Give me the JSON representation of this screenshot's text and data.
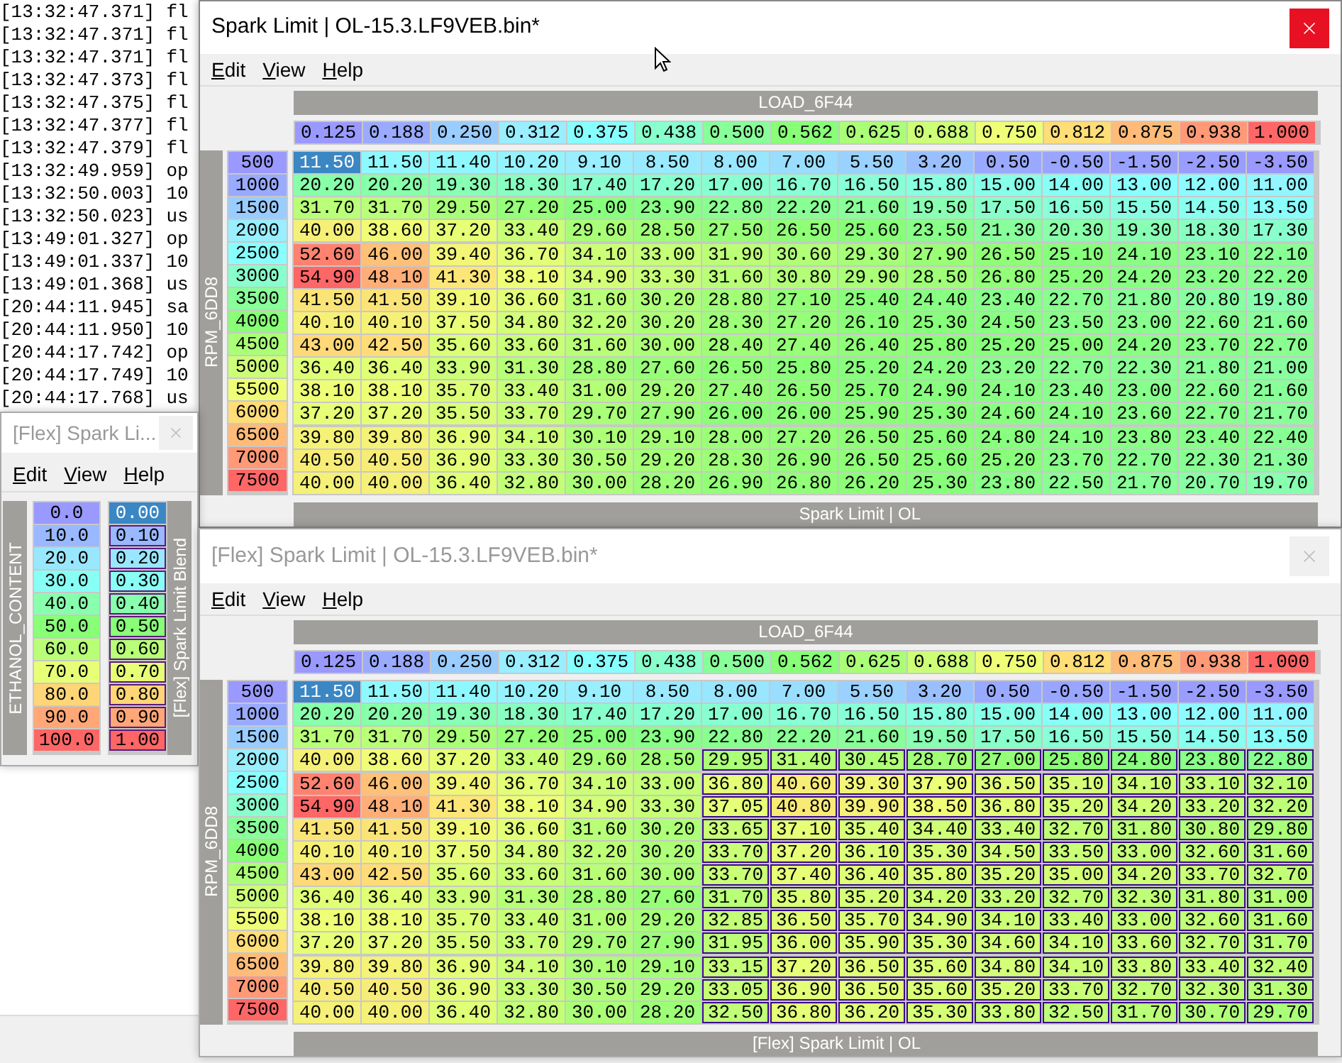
{
  "log": [
    {
      "time": "[13:32:47.371]",
      "text": "fl"
    },
    {
      "time": "[13:32:47.371]",
      "text": "fl"
    },
    {
      "time": "[13:32:47.371]",
      "text": "fl"
    },
    {
      "time": "[13:32:47.373]",
      "text": "fl"
    },
    {
      "time": "[13:32:47.375]",
      "text": "fl"
    },
    {
      "time": "[13:32:47.377]",
      "text": "fl"
    },
    {
      "time": "[13:32:47.379]",
      "text": "fl"
    },
    {
      "time": "[13:32:49.959]",
      "text": "op"
    },
    {
      "time": "[13:32:50.003]",
      "text": "10"
    },
    {
      "time": "[13:32:50.023]",
      "text": "us"
    },
    {
      "time": "[13:49:01.327]",
      "text": "op"
    },
    {
      "time": "[13:49:01.337]",
      "text": "10"
    },
    {
      "time": "[13:49:01.368]",
      "text": "us"
    },
    {
      "time": "[20:44:11.945]",
      "text": "sa"
    },
    {
      "time": "[20:44:11.950]",
      "text": "10"
    },
    {
      "time": "[20:44:17.742]",
      "text": "op"
    },
    {
      "time": "[20:44:17.749]",
      "text": "10"
    },
    {
      "time": "[20:44:17.768]",
      "text": "us"
    }
  ],
  "windows": [
    {
      "kind": "map",
      "title": "Spark Limit | OL-15.3.LF9VEB.bin*",
      "active": true,
      "menu": [
        "Edit",
        "View",
        "Help"
      ],
      "x_label": "LOAD_6F44",
      "x_axis": [
        "0.125",
        "0.188",
        "0.250",
        "0.312",
        "0.375",
        "0.438",
        "0.500",
        "0.562",
        "0.625",
        "0.688",
        "0.750",
        "0.812",
        "0.875",
        "0.938",
        "1.000"
      ],
      "y_label": "RPM_6DD8",
      "footer": "Spark Limit | OL",
      "rows": [
        {
          "rpm": "500",
          "cells": [
            "11.50",
            "11.50",
            "11.40",
            "10.20",
            "9.10",
            "8.50",
            "8.00",
            "7.00",
            "5.50",
            "3.20",
            "0.50",
            "-0.50",
            "-1.50",
            "-2.50",
            "-3.50"
          ],
          "selected": [
            true,
            false,
            false,
            false,
            false,
            false,
            false,
            false,
            false,
            false,
            false,
            false,
            false,
            false,
            false
          ]
        },
        {
          "rpm": "1000",
          "cells": [
            "20.20",
            "20.20",
            "19.30",
            "18.30",
            "17.40",
            "17.20",
            "17.00",
            "16.70",
            "16.50",
            "15.80",
            "15.00",
            "14.00",
            "13.00",
            "12.00",
            "11.00"
          ],
          "selected": [
            false,
            false,
            false,
            false,
            false,
            false,
            false,
            false,
            false,
            false,
            false,
            false,
            false,
            false,
            false
          ]
        },
        {
          "rpm": "1500",
          "cells": [
            "31.70",
            "31.70",
            "29.50",
            "27.20",
            "25.00",
            "23.90",
            "22.80",
            "22.20",
            "21.60",
            "19.50",
            "17.50",
            "16.50",
            "15.50",
            "14.50",
            "13.50"
          ],
          "selected": [
            false,
            false,
            false,
            false,
            false,
            false,
            false,
            false,
            false,
            false,
            false,
            false,
            false,
            false,
            false
          ]
        },
        {
          "rpm": "2000",
          "cells": [
            "40.00",
            "38.60",
            "37.20",
            "33.40",
            "29.60",
            "28.50",
            "27.50",
            "26.50",
            "25.60",
            "23.50",
            "21.30",
            "20.30",
            "19.30",
            "18.30",
            "17.30"
          ],
          "selected": [
            false,
            false,
            false,
            false,
            false,
            false,
            false,
            false,
            false,
            false,
            false,
            false,
            false,
            false,
            false
          ]
        },
        {
          "rpm": "2500",
          "cells": [
            "52.60",
            "46.00",
            "39.40",
            "36.70",
            "34.10",
            "33.00",
            "31.90",
            "30.60",
            "29.30",
            "27.90",
            "26.50",
            "25.10",
            "24.10",
            "23.10",
            "22.10"
          ],
          "selected": [
            false,
            false,
            false,
            false,
            false,
            false,
            false,
            false,
            false,
            false,
            false,
            false,
            false,
            false,
            false
          ]
        },
        {
          "rpm": "3000",
          "cells": [
            "54.90",
            "48.10",
            "41.30",
            "38.10",
            "34.90",
            "33.30",
            "31.60",
            "30.80",
            "29.90",
            "28.50",
            "26.80",
            "25.20",
            "24.20",
            "23.20",
            "22.20"
          ],
          "selected": [
            false,
            false,
            false,
            false,
            false,
            false,
            false,
            false,
            false,
            false,
            false,
            false,
            false,
            false,
            false
          ]
        },
        {
          "rpm": "3500",
          "cells": [
            "41.50",
            "41.50",
            "39.10",
            "36.60",
            "31.60",
            "30.20",
            "28.80",
            "27.10",
            "25.40",
            "24.40",
            "23.40",
            "22.70",
            "21.80",
            "20.80",
            "19.80"
          ],
          "selected": [
            false,
            false,
            false,
            false,
            false,
            false,
            false,
            false,
            false,
            false,
            false,
            false,
            false,
            false,
            false
          ]
        },
        {
          "rpm": "4000",
          "cells": [
            "40.10",
            "40.10",
            "37.50",
            "34.80",
            "32.20",
            "30.20",
            "28.30",
            "27.20",
            "26.10",
            "25.30",
            "24.50",
            "23.50",
            "23.00",
            "22.60",
            "21.60"
          ],
          "selected": [
            false,
            false,
            false,
            false,
            false,
            false,
            false,
            false,
            false,
            false,
            false,
            false,
            false,
            false,
            false
          ]
        },
        {
          "rpm": "4500",
          "cells": [
            "43.00",
            "42.50",
            "35.60",
            "33.60",
            "31.60",
            "30.00",
            "28.40",
            "27.40",
            "26.40",
            "25.80",
            "25.20",
            "25.00",
            "24.20",
            "23.70",
            "22.70"
          ],
          "selected": [
            false,
            false,
            false,
            false,
            false,
            false,
            false,
            false,
            false,
            false,
            false,
            false,
            false,
            false,
            false
          ]
        },
        {
          "rpm": "5000",
          "cells": [
            "36.40",
            "36.40",
            "33.90",
            "31.30",
            "28.80",
            "27.60",
            "26.50",
            "25.80",
            "25.20",
            "24.20",
            "23.20",
            "22.70",
            "22.30",
            "21.80",
            "21.00"
          ],
          "selected": [
            false,
            false,
            false,
            false,
            false,
            false,
            false,
            false,
            false,
            false,
            false,
            false,
            false,
            false,
            false
          ]
        },
        {
          "rpm": "5500",
          "cells": [
            "38.10",
            "38.10",
            "35.70",
            "33.40",
            "31.00",
            "29.20",
            "27.40",
            "26.50",
            "25.70",
            "24.90",
            "24.10",
            "23.40",
            "23.00",
            "22.60",
            "21.60"
          ],
          "selected": [
            false,
            false,
            false,
            false,
            false,
            false,
            false,
            false,
            false,
            false,
            false,
            false,
            false,
            false,
            false
          ]
        },
        {
          "rpm": "6000",
          "cells": [
            "37.20",
            "37.20",
            "35.50",
            "33.70",
            "29.70",
            "27.90",
            "26.00",
            "26.00",
            "25.90",
            "25.30",
            "24.60",
            "24.10",
            "23.60",
            "22.70",
            "21.70"
          ],
          "selected": [
            false,
            false,
            false,
            false,
            false,
            false,
            false,
            false,
            false,
            false,
            false,
            false,
            false,
            false,
            false
          ]
        },
        {
          "rpm": "6500",
          "cells": [
            "39.80",
            "39.80",
            "36.90",
            "34.10",
            "30.10",
            "29.10",
            "28.00",
            "27.20",
            "26.50",
            "25.60",
            "24.80",
            "24.10",
            "23.80",
            "23.40",
            "22.40"
          ],
          "selected": [
            false,
            false,
            false,
            false,
            false,
            false,
            false,
            false,
            false,
            false,
            false,
            false,
            false,
            false,
            false
          ]
        },
        {
          "rpm": "7000",
          "cells": [
            "40.50",
            "40.50",
            "36.90",
            "33.30",
            "30.50",
            "29.20",
            "28.30",
            "26.90",
            "26.50",
            "25.60",
            "25.20",
            "23.70",
            "22.70",
            "22.30",
            "21.30"
          ],
          "selected": [
            false,
            false,
            false,
            false,
            false,
            false,
            false,
            false,
            false,
            false,
            false,
            false,
            false,
            false,
            false
          ]
        },
        {
          "rpm": "7500",
          "cells": [
            "40.00",
            "40.00",
            "36.40",
            "32.80",
            "30.00",
            "28.20",
            "26.90",
            "26.80",
            "26.20",
            "25.30",
            "23.80",
            "22.50",
            "21.70",
            "20.70",
            "19.70"
          ],
          "selected": [
            false,
            false,
            false,
            false,
            false,
            false,
            false,
            false,
            false,
            false,
            false,
            false,
            false,
            false,
            false
          ]
        }
      ]
    },
    {
      "kind": "blend",
      "title": "[Flex] Spark Li...",
      "active": false,
      "menu": [
        "Edit",
        "View",
        "Help"
      ],
      "y_label": "ETHANOL_CONTENT",
      "side_label": "[Flex] Spark Limit Blend",
      "rows": [
        {
          "axis": "0.0",
          "value": "0.00",
          "selected": true,
          "changed": false
        },
        {
          "axis": "10.0",
          "value": "0.10",
          "selected": false,
          "changed": true
        },
        {
          "axis": "20.0",
          "value": "0.20",
          "selected": false,
          "changed": true
        },
        {
          "axis": "30.0",
          "value": "0.30",
          "selected": false,
          "changed": true
        },
        {
          "axis": "40.0",
          "value": "0.40",
          "selected": false,
          "changed": true
        },
        {
          "axis": "50.0",
          "value": "0.50",
          "selected": false,
          "changed": true
        },
        {
          "axis": "60.0",
          "value": "0.60",
          "selected": false,
          "changed": true
        },
        {
          "axis": "70.0",
          "value": "0.70",
          "selected": false,
          "changed": true
        },
        {
          "axis": "80.0",
          "value": "0.80",
          "selected": false,
          "changed": true
        },
        {
          "axis": "90.0",
          "value": "0.90",
          "selected": false,
          "changed": true
        },
        {
          "axis": "100.0",
          "value": "1.00",
          "selected": false,
          "changed": true
        }
      ]
    },
    {
      "kind": "map",
      "title": "[Flex] Spark Limit | OL-15.3.LF9VEB.bin*",
      "active": false,
      "menu": [
        "Edit",
        "View",
        "Help"
      ],
      "x_label": "LOAD_6F44",
      "x_axis": [
        "0.125",
        "0.188",
        "0.250",
        "0.312",
        "0.375",
        "0.438",
        "0.500",
        "0.562",
        "0.625",
        "0.688",
        "0.750",
        "0.812",
        "0.875",
        "0.938",
        "1.000"
      ],
      "y_label": "RPM_6DD8",
      "footer": "[Flex] Spark Limit | OL",
      "rows": [
        {
          "rpm": "500",
          "cells": [
            "11.50",
            "11.50",
            "11.40",
            "10.20",
            "9.10",
            "8.50",
            "8.00",
            "7.00",
            "5.50",
            "3.20",
            "0.50",
            "-0.50",
            "-1.50",
            "-2.50",
            "-3.50"
          ],
          "selected": [
            true,
            false,
            false,
            false,
            false,
            false,
            false,
            false,
            false,
            false,
            false,
            false,
            false,
            false,
            false
          ],
          "changed": [
            false,
            false,
            false,
            false,
            false,
            false,
            false,
            false,
            false,
            false,
            false,
            false,
            false,
            false,
            false
          ]
        },
        {
          "rpm": "1000",
          "cells": [
            "20.20",
            "20.20",
            "19.30",
            "18.30",
            "17.40",
            "17.20",
            "17.00",
            "16.70",
            "16.50",
            "15.80",
            "15.00",
            "14.00",
            "13.00",
            "12.00",
            "11.00"
          ],
          "selected": [
            false,
            false,
            false,
            false,
            false,
            false,
            false,
            false,
            false,
            false,
            false,
            false,
            false,
            false,
            false
          ],
          "changed": [
            false,
            false,
            false,
            false,
            false,
            false,
            false,
            false,
            false,
            false,
            false,
            false,
            false,
            false,
            false
          ]
        },
        {
          "rpm": "1500",
          "cells": [
            "31.70",
            "31.70",
            "29.50",
            "27.20",
            "25.00",
            "23.90",
            "22.80",
            "22.20",
            "21.60",
            "19.50",
            "17.50",
            "16.50",
            "15.50",
            "14.50",
            "13.50"
          ],
          "selected": [
            false,
            false,
            false,
            false,
            false,
            false,
            false,
            false,
            false,
            false,
            false,
            false,
            false,
            false,
            false
          ],
          "changed": [
            false,
            false,
            false,
            false,
            false,
            false,
            false,
            false,
            false,
            false,
            false,
            false,
            false,
            false,
            false
          ]
        },
        {
          "rpm": "2000",
          "cells": [
            "40.00",
            "38.60",
            "37.20",
            "33.40",
            "29.60",
            "28.50",
            "29.95",
            "31.40",
            "30.45",
            "28.70",
            "27.00",
            "25.80",
            "24.80",
            "23.80",
            "22.80"
          ],
          "selected": [
            false,
            false,
            false,
            false,
            false,
            false,
            false,
            false,
            false,
            false,
            false,
            false,
            false,
            false,
            false
          ],
          "changed": [
            false,
            false,
            false,
            false,
            false,
            false,
            true,
            true,
            true,
            true,
            true,
            true,
            true,
            true,
            true
          ]
        },
        {
          "rpm": "2500",
          "cells": [
            "52.60",
            "46.00",
            "39.40",
            "36.70",
            "34.10",
            "33.00",
            "36.80",
            "40.60",
            "39.30",
            "37.90",
            "36.50",
            "35.10",
            "34.10",
            "33.10",
            "32.10"
          ],
          "selected": [
            false,
            false,
            false,
            false,
            false,
            false,
            false,
            false,
            false,
            false,
            false,
            false,
            false,
            false,
            false
          ],
          "changed": [
            false,
            false,
            false,
            false,
            false,
            false,
            true,
            true,
            true,
            true,
            true,
            true,
            true,
            true,
            true
          ]
        },
        {
          "rpm": "3000",
          "cells": [
            "54.90",
            "48.10",
            "41.30",
            "38.10",
            "34.90",
            "33.30",
            "37.05",
            "40.80",
            "39.90",
            "38.50",
            "36.80",
            "35.20",
            "34.20",
            "33.20",
            "32.20"
          ],
          "selected": [
            false,
            false,
            false,
            false,
            false,
            false,
            false,
            false,
            false,
            false,
            false,
            false,
            false,
            false,
            false
          ],
          "changed": [
            false,
            false,
            false,
            false,
            false,
            false,
            true,
            true,
            true,
            true,
            true,
            true,
            true,
            true,
            true
          ]
        },
        {
          "rpm": "3500",
          "cells": [
            "41.50",
            "41.50",
            "39.10",
            "36.60",
            "31.60",
            "30.20",
            "33.65",
            "37.10",
            "35.40",
            "34.40",
            "33.40",
            "32.70",
            "31.80",
            "30.80",
            "29.80"
          ],
          "selected": [
            false,
            false,
            false,
            false,
            false,
            false,
            false,
            false,
            false,
            false,
            false,
            false,
            false,
            false,
            false
          ],
          "changed": [
            false,
            false,
            false,
            false,
            false,
            false,
            true,
            true,
            true,
            true,
            true,
            true,
            true,
            true,
            true
          ]
        },
        {
          "rpm": "4000",
          "cells": [
            "40.10",
            "40.10",
            "37.50",
            "34.80",
            "32.20",
            "30.20",
            "33.70",
            "37.20",
            "36.10",
            "35.30",
            "34.50",
            "33.50",
            "33.00",
            "32.60",
            "31.60"
          ],
          "selected": [
            false,
            false,
            false,
            false,
            false,
            false,
            false,
            false,
            false,
            false,
            false,
            false,
            false,
            false,
            false
          ],
          "changed": [
            false,
            false,
            false,
            false,
            false,
            false,
            true,
            true,
            true,
            true,
            true,
            true,
            true,
            true,
            true
          ]
        },
        {
          "rpm": "4500",
          "cells": [
            "43.00",
            "42.50",
            "35.60",
            "33.60",
            "31.60",
            "30.00",
            "33.70",
            "37.40",
            "36.40",
            "35.80",
            "35.20",
            "35.00",
            "34.20",
            "33.70",
            "32.70"
          ],
          "selected": [
            false,
            false,
            false,
            false,
            false,
            false,
            false,
            false,
            false,
            false,
            false,
            false,
            false,
            false,
            false
          ],
          "changed": [
            false,
            false,
            false,
            false,
            false,
            false,
            true,
            true,
            true,
            true,
            true,
            true,
            true,
            true,
            true
          ]
        },
        {
          "rpm": "5000",
          "cells": [
            "36.40",
            "36.40",
            "33.90",
            "31.30",
            "28.80",
            "27.60",
            "31.70",
            "35.80",
            "35.20",
            "34.20",
            "33.20",
            "32.70",
            "32.30",
            "31.80",
            "31.00"
          ],
          "selected": [
            false,
            false,
            false,
            false,
            false,
            false,
            false,
            false,
            false,
            false,
            false,
            false,
            false,
            false,
            false
          ],
          "changed": [
            false,
            false,
            false,
            false,
            false,
            false,
            true,
            true,
            true,
            true,
            true,
            true,
            true,
            true,
            true
          ]
        },
        {
          "rpm": "5500",
          "cells": [
            "38.10",
            "38.10",
            "35.70",
            "33.40",
            "31.00",
            "29.20",
            "32.85",
            "36.50",
            "35.70",
            "34.90",
            "34.10",
            "33.40",
            "33.00",
            "32.60",
            "31.60"
          ],
          "selected": [
            false,
            false,
            false,
            false,
            false,
            false,
            false,
            false,
            false,
            false,
            false,
            false,
            false,
            false,
            false
          ],
          "changed": [
            false,
            false,
            false,
            false,
            false,
            false,
            true,
            true,
            true,
            true,
            true,
            true,
            true,
            true,
            true
          ]
        },
        {
          "rpm": "6000",
          "cells": [
            "37.20",
            "37.20",
            "35.50",
            "33.70",
            "29.70",
            "27.90",
            "31.95",
            "36.00",
            "35.90",
            "35.30",
            "34.60",
            "34.10",
            "33.60",
            "32.70",
            "31.70"
          ],
          "selected": [
            false,
            false,
            false,
            false,
            false,
            false,
            false,
            false,
            false,
            false,
            false,
            false,
            false,
            false,
            false
          ],
          "changed": [
            false,
            false,
            false,
            false,
            false,
            false,
            true,
            true,
            true,
            true,
            true,
            true,
            true,
            true,
            true
          ]
        },
        {
          "rpm": "6500",
          "cells": [
            "39.80",
            "39.80",
            "36.90",
            "34.10",
            "30.10",
            "29.10",
            "33.15",
            "37.20",
            "36.50",
            "35.60",
            "34.80",
            "34.10",
            "33.80",
            "33.40",
            "32.40"
          ],
          "selected": [
            false,
            false,
            false,
            false,
            false,
            false,
            false,
            false,
            false,
            false,
            false,
            false,
            false,
            false,
            false
          ],
          "changed": [
            false,
            false,
            false,
            false,
            false,
            false,
            true,
            true,
            true,
            true,
            true,
            true,
            true,
            true,
            true
          ]
        },
        {
          "rpm": "7000",
          "cells": [
            "40.50",
            "40.50",
            "36.90",
            "33.30",
            "30.50",
            "29.20",
            "33.05",
            "36.90",
            "36.50",
            "35.60",
            "35.20",
            "33.70",
            "32.70",
            "32.30",
            "31.30"
          ],
          "selected": [
            false,
            false,
            false,
            false,
            false,
            false,
            false,
            false,
            false,
            false,
            false,
            false,
            false,
            false,
            false
          ],
          "changed": [
            false,
            false,
            false,
            false,
            false,
            false,
            true,
            true,
            true,
            true,
            true,
            true,
            true,
            true,
            true
          ]
        },
        {
          "rpm": "7500",
          "cells": [
            "40.00",
            "40.00",
            "36.40",
            "32.80",
            "30.00",
            "28.20",
            "32.50",
            "36.80",
            "36.20",
            "35.30",
            "33.80",
            "32.50",
            "31.70",
            "30.70",
            "29.70"
          ],
          "selected": [
            false,
            false,
            false,
            false,
            false,
            false,
            false,
            false,
            false,
            false,
            false,
            false,
            false,
            false,
            false
          ],
          "changed": [
            false,
            false,
            false,
            false,
            false,
            false,
            true,
            true,
            true,
            true,
            true,
            true,
            true,
            true,
            true
          ]
        }
      ]
    }
  ]
}
